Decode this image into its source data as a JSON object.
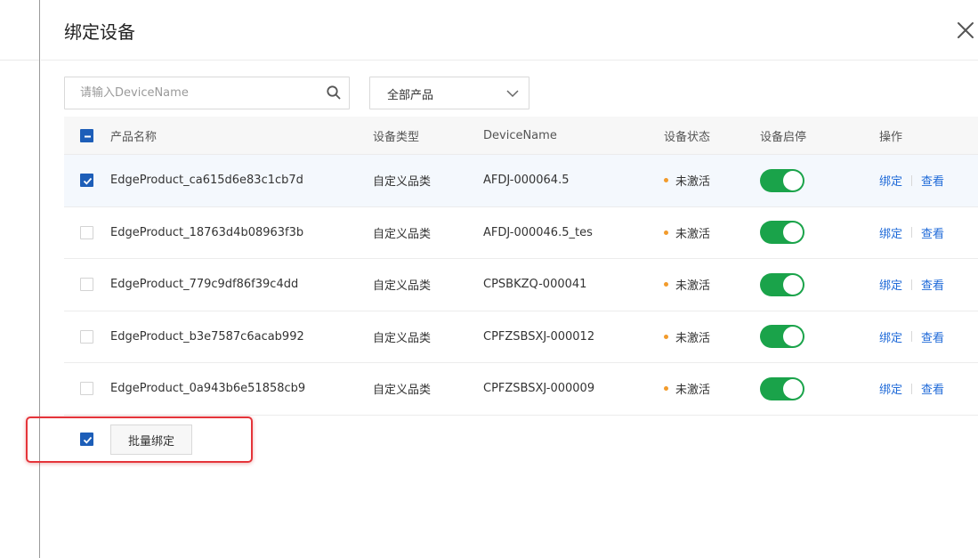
{
  "dialog": {
    "title": "绑定设备"
  },
  "filters": {
    "search_placeholder": "请输入DeviceName",
    "search_value": "",
    "product_select": "全部产品"
  },
  "table": {
    "headers": {
      "name": "产品名称",
      "type": "设备类型",
      "device": "DeviceName",
      "status": "设备状态",
      "switch": "设备启停",
      "ops": "操作"
    },
    "rows": [
      {
        "name": "EdgeProduct_ca615d6e83c1cb7d",
        "type": "自定义品类",
        "device": "AFDJ-000064.5",
        "status": "未激活",
        "checked": true,
        "enabled": true,
        "bind": "绑定",
        "view": "查看"
      },
      {
        "name": "EdgeProduct_18763d4b08963f3b",
        "type": "自定义品类",
        "device": "AFDJ-000046.5_tes",
        "status": "未激活",
        "checked": false,
        "enabled": true,
        "bind": "绑定",
        "view": "查看"
      },
      {
        "name": "EdgeProduct_779c9df86f39c4dd",
        "type": "自定义品类",
        "device": "CPSBKZQ-000041",
        "status": "未激活",
        "checked": false,
        "enabled": true,
        "bind": "绑定",
        "view": "查看"
      },
      {
        "name": "EdgeProduct_b3e7587c6acab992",
        "type": "自定义品类",
        "device": "CPFZSBSXJ-000012",
        "status": "未激活",
        "checked": false,
        "enabled": true,
        "bind": "绑定",
        "view": "查看"
      },
      {
        "name": "EdgeProduct_0a943b6e51858cb9",
        "type": "自定义品类",
        "device": "CPFZSBSXJ-000009",
        "status": "未激活",
        "checked": false,
        "enabled": true,
        "bind": "绑定",
        "view": "查看"
      }
    ]
  },
  "footer": {
    "batch_bind": "批量绑定"
  },
  "colors": {
    "primary": "#1d5eb8",
    "link": "#1f6ad8",
    "switch_on": "#1aa34a",
    "status_dot": "#f29b2c",
    "highlight": "#e5343a"
  }
}
